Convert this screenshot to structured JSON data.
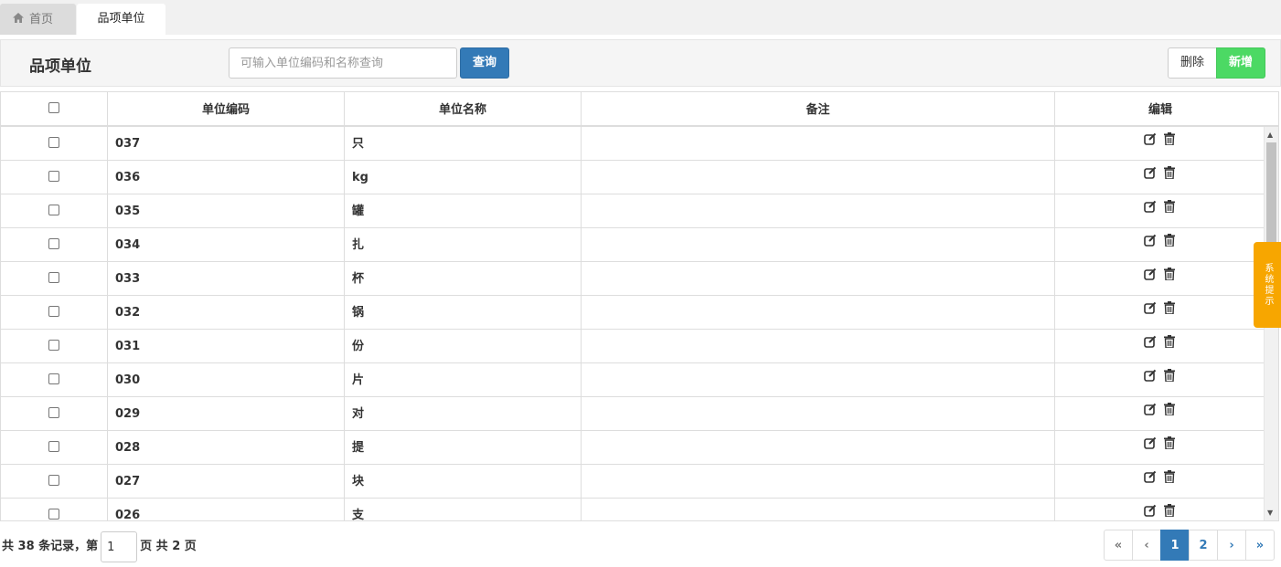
{
  "tabs": {
    "home_label": "首页",
    "active_label": "品项单位"
  },
  "toolbar": {
    "title": "品项单位",
    "search_placeholder": "可输入单位编码和名称查询",
    "query_label": "查询",
    "delete_label": "删除",
    "add_label": "新增"
  },
  "table": {
    "headers": {
      "code": "单位编码",
      "name": "单位名称",
      "note": "备注",
      "edit": "编辑"
    },
    "rows": [
      {
        "code": "037",
        "name": "只",
        "note": ""
      },
      {
        "code": "036",
        "name": "kg",
        "note": ""
      },
      {
        "code": "035",
        "name": "罐",
        "note": ""
      },
      {
        "code": "034",
        "name": "扎",
        "note": ""
      },
      {
        "code": "033",
        "name": "杯",
        "note": ""
      },
      {
        "code": "032",
        "name": "锅",
        "note": ""
      },
      {
        "code": "031",
        "name": "份",
        "note": ""
      },
      {
        "code": "030",
        "name": "片",
        "note": ""
      },
      {
        "code": "029",
        "name": "对",
        "note": ""
      },
      {
        "code": "028",
        "name": "提",
        "note": ""
      },
      {
        "code": "027",
        "name": "块",
        "note": ""
      },
      {
        "code": "026",
        "name": "支",
        "note": ""
      }
    ]
  },
  "side_tab": {
    "label": "系统提示"
  },
  "footer": {
    "prefix": "共 38 条记录，第",
    "current_page": "1",
    "suffix": "页 共 2 页"
  },
  "pager": {
    "first": "«",
    "prev": "‹",
    "pages": [
      "1",
      "2"
    ],
    "next": "›",
    "last": "»"
  },
  "colors": {
    "primary": "#337ab7",
    "success": "#4cd964",
    "warning": "#f7a600"
  }
}
